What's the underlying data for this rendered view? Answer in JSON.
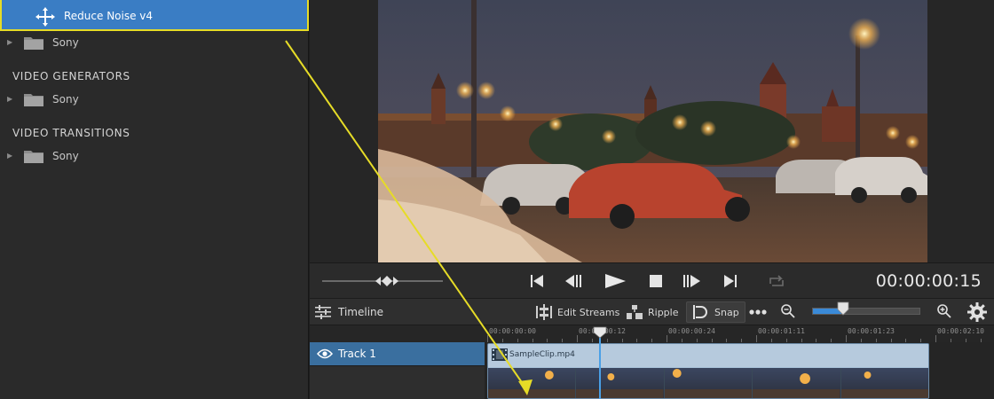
{
  "effects_panel": {
    "selected_effect": "Reduce Noise v4",
    "rows": [
      {
        "type": "folder",
        "label": "Sony"
      },
      {
        "type": "section",
        "label": "VIDEO GENERATORS"
      },
      {
        "type": "folder",
        "label": "Sony"
      },
      {
        "type": "section",
        "label": "VIDEO TRANSITIONS"
      },
      {
        "type": "folder",
        "label": "Sony"
      }
    ]
  },
  "transport": {
    "timecode": "00:00:00:15",
    "buttons": [
      "go-to-start",
      "previous-frame",
      "play",
      "stop",
      "next-frame",
      "go-to-end",
      "loop"
    ]
  },
  "timeline": {
    "title": "Timeline",
    "tools": {
      "edit_streams": "Edit Streams",
      "ripple": "Ripple",
      "snap": "Snap"
    },
    "zoom_level": 0.29,
    "ruler_labels": [
      "00:00:00:00",
      "00:00:00:12",
      "00:00:00:24",
      "00:00:01:11",
      "00:00:01:23",
      "00:00:02:10"
    ],
    "tracks": [
      {
        "name": "Track 1",
        "clip": {
          "name": "SampleClip.mp4"
        }
      }
    ]
  },
  "colors": {
    "selection_blue": "#3a7dc4",
    "highlight_yellow": "#e6dc27",
    "track_header": "#3a6f9f",
    "clip": "#a7c1d8",
    "playhead": "#4aa0e6"
  }
}
